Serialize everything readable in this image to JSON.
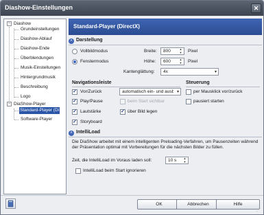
{
  "window": {
    "title": "Diashow-Einstellungen",
    "close_glyph": "✕"
  },
  "tree": {
    "diashow": "Diashow",
    "items": [
      "Grundeinstellungen",
      "Diashow-Ablauf",
      "Diashow-Ende",
      "Überblendungen",
      "Musik-Einstellungen",
      "Hintergrundmusik",
      "Beschreibung",
      "Logo"
    ],
    "player": "DiaShow-Player",
    "standard_player": "Standard-Player (Di",
    "software_player": "Software-Player"
  },
  "header": {
    "title": "Standard-Player (DirectX)"
  },
  "darstellung": {
    "title": "Darstellung",
    "vollbild": "Vollbildmodus",
    "fenster": "Fenstermodus",
    "breite_label": "Breite:",
    "breite_value": "800",
    "hoehe_label": "Höhe:",
    "hoehe_value": "600",
    "pixel": "Pixel",
    "kanten_label": "Kantenglättung:",
    "kanten_value": "4x"
  },
  "navigation": {
    "title": "Navigationsleiste",
    "vor_zurueck": "Vor/Zurück",
    "play_pause": "Play/Pause",
    "lautstaerke": "Lautstärke",
    "storyboard": "Storyboard",
    "mode_value": "automatisch ein- und ausbl",
    "beim_start": "beim Start sichtbar",
    "ueber_bild": "über Bild legen"
  },
  "steuerung": {
    "title": "Steuerung",
    "mausklick": "per Mausklick vor/zurück",
    "pausiert": "pausiert starten"
  },
  "intelliload": {
    "title": "IntelliLoad",
    "description": "Die DiaShow arbeitet mit einem intelligenten Preloading-Verfahren, um Pausenzeiten während der Präsentation optimal mit Vorbereitungen für die nächsten Bilder zu füllen.",
    "zeit_label": "Zeit, die IntelliLoad im Voraus laden soll:",
    "zeit_value": "10 s",
    "ignore": "IntelliLoad beim Start ignorieren"
  },
  "footer": {
    "ok": "OK",
    "cancel": "Abbrechen",
    "help": "Hilfe"
  },
  "colors": {
    "accent": "#2b56a8",
    "header": "#3f65b4",
    "titlebar": "#3d4450"
  }
}
